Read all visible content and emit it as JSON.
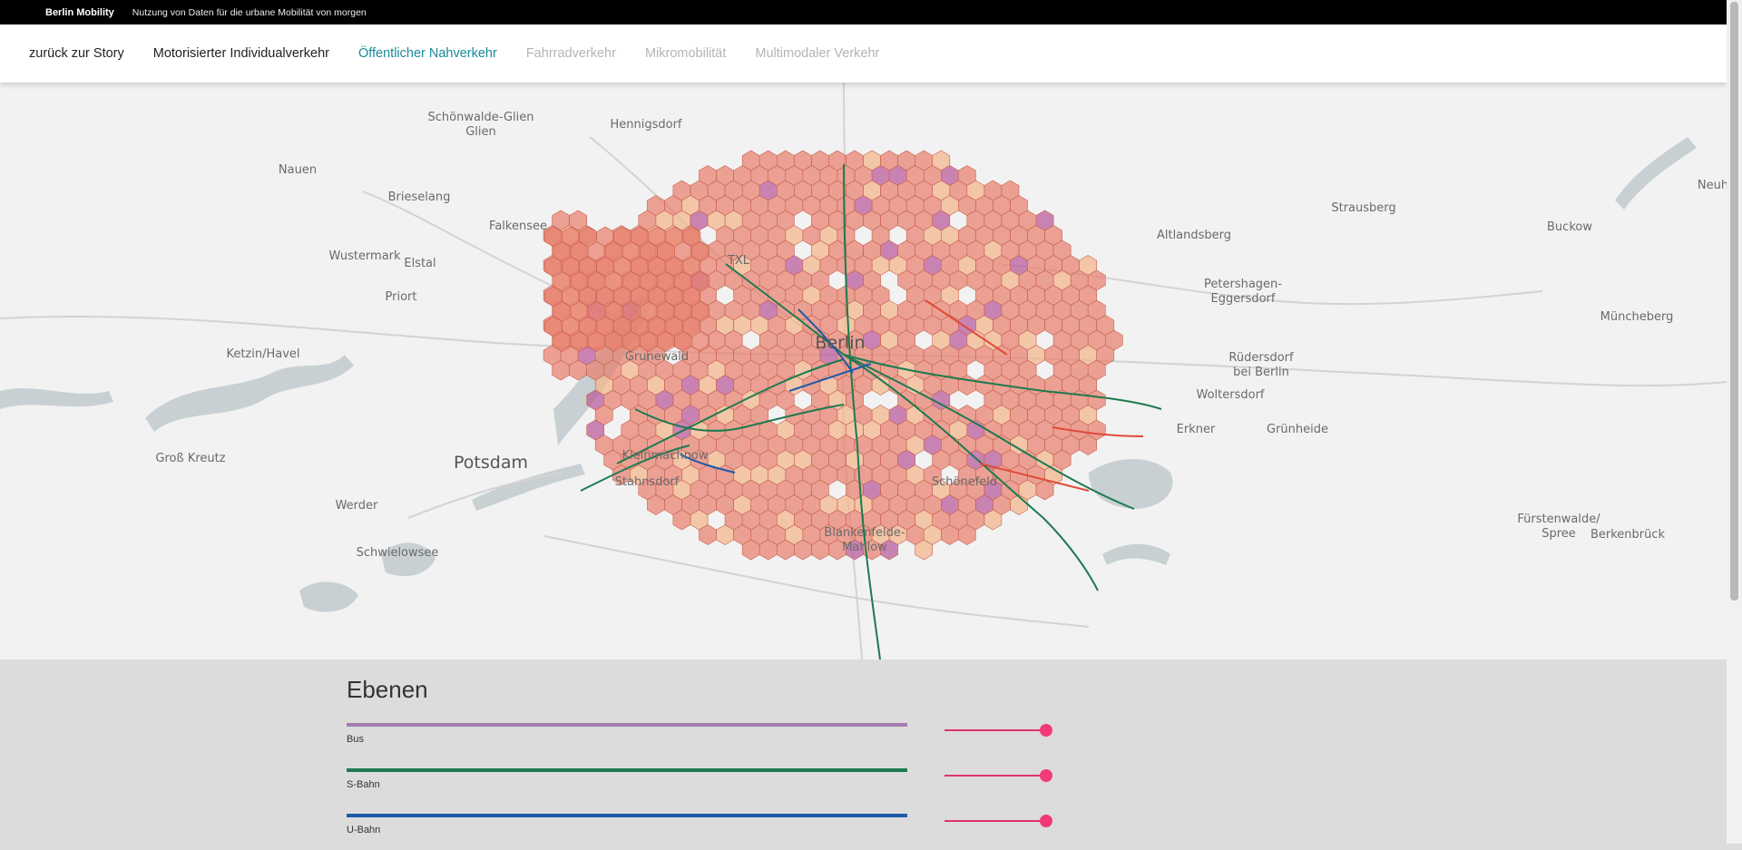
{
  "topbar": {
    "brand": "Berlin Mobility",
    "tagline": "Nutzung von Daten für die urbane Mobilität von morgen"
  },
  "nav": {
    "items": [
      {
        "label": "zurück zur Story",
        "state": "normal"
      },
      {
        "label": "Motorisierter Individualverkehr",
        "state": "normal"
      },
      {
        "label": "Öffentlicher Nahverkehr",
        "state": "active"
      },
      {
        "label": "Fahrradverkehr",
        "state": "disabled"
      },
      {
        "label": "Mikromobilität",
        "state": "disabled"
      },
      {
        "label": "Multimodaler Verkehr",
        "state": "disabled"
      }
    ]
  },
  "map": {
    "city_label": "Berlin",
    "places": [
      "Schönwalde-Glien",
      "Hennigsdorf",
      "Nauen",
      "Brieselang",
      "Falkensee",
      "Wustermark",
      "Elstal",
      "Priort",
      "Ketzin/Havel",
      "Groß Kreutz",
      "Potsdam",
      "Werder",
      "Schwielowsee",
      "Grunewald",
      "Kleinmachnow",
      "Stahnsdorf",
      "Blankenfelde-Mahlow",
      "Schönefeld",
      "Altlandsberg",
      "Strausberg",
      "Buckow",
      "Neuh",
      "Petershagen-Eggersdorf",
      "Müncheberg",
      "Rüdersdorf bei Berlin",
      "Woltersdorf",
      "Erkner",
      "Grünheide",
      "Fürstenwalde/Spree",
      "Berkenbrück",
      "TXL"
    ],
    "colors": {
      "hex_fill": "#e8806e",
      "hex_purple": "#b8589a",
      "hex_light": "#f2b48a",
      "background": "#f2f2f2",
      "water": "#c9d0d3"
    }
  },
  "layers": {
    "title": "Ebenen",
    "items": [
      {
        "name": "Bus",
        "color": "#a57cb3",
        "opacity": 1.0
      },
      {
        "name": "S-Bahn",
        "color": "#1d7a4f",
        "opacity": 1.0
      },
      {
        "name": "U-Bahn",
        "color": "#1f5aa8",
        "opacity": 1.0
      }
    ]
  }
}
